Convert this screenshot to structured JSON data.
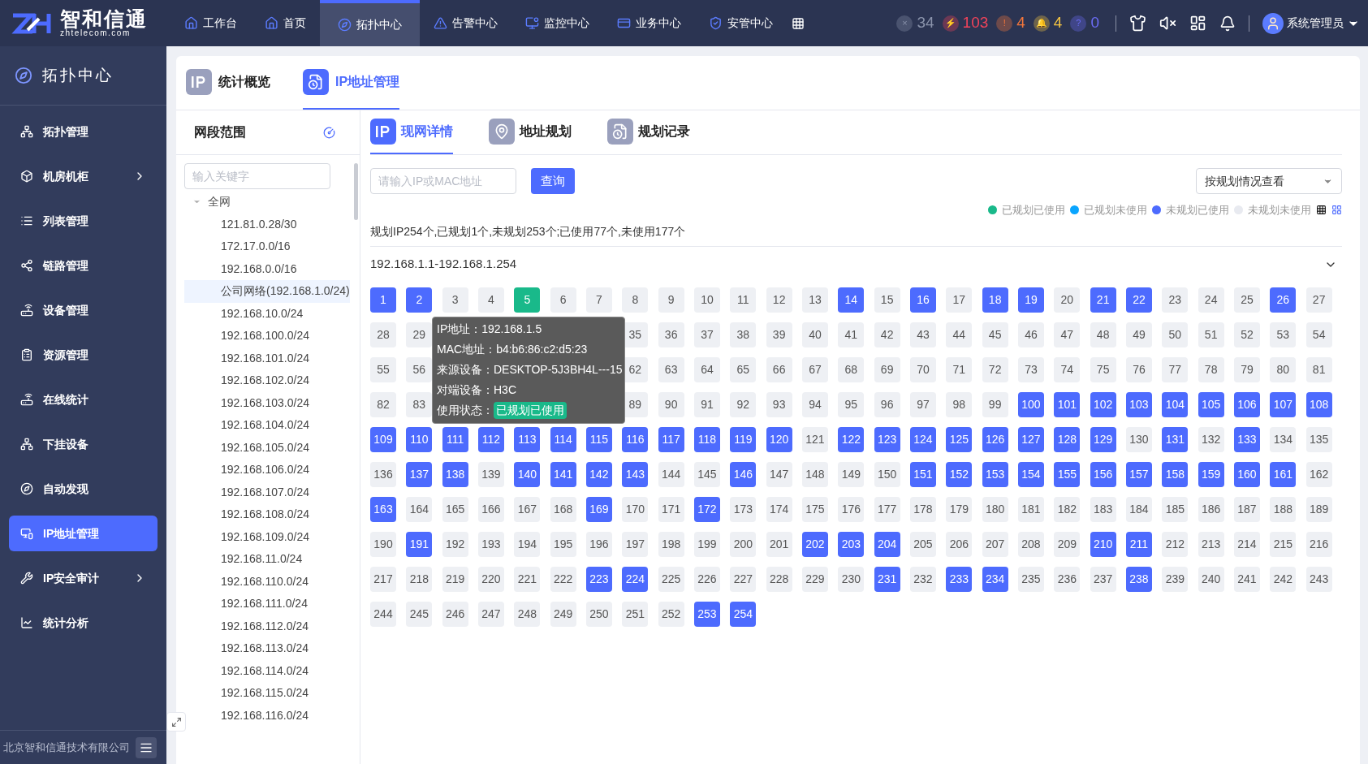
{
  "logo": {
    "name": "智和信通",
    "domain": "zhtelecom.com"
  },
  "nav": [
    {
      "label": "工作台",
      "selected": false
    },
    {
      "label": "首页",
      "selected": false
    },
    {
      "label": "拓扑中心",
      "selected": true
    },
    {
      "label": "告警中心",
      "selected": false
    },
    {
      "label": "监控中心",
      "selected": false
    },
    {
      "label": "业务中心",
      "selected": false
    },
    {
      "label": "安管中心",
      "selected": false
    }
  ],
  "alarms": [
    {
      "symbol": "×",
      "count": "34",
      "color": "#8a93ab"
    },
    {
      "symbol": "⚡",
      "count": "103",
      "color": "#f0435a"
    },
    {
      "symbol": "!",
      "count": "4",
      "color": "#f5773b"
    },
    {
      "symbol": "🔔",
      "count": "4",
      "color": "#f5c542"
    },
    {
      "symbol": "?",
      "count": "0",
      "color": "#6b6cf5"
    }
  ],
  "user": {
    "name": "系统管理员"
  },
  "sidebar": {
    "title": "拓扑中心",
    "footer": "北京智和信通技术有限公司",
    "items": [
      {
        "label": "拓扑管理",
        "selected": false,
        "has_submenu": false
      },
      {
        "label": "机房机柜",
        "selected": false,
        "has_submenu": true
      },
      {
        "label": "列表管理",
        "selected": false,
        "has_submenu": false
      },
      {
        "label": "链路管理",
        "selected": false,
        "has_submenu": false
      },
      {
        "label": "设备管理",
        "selected": false,
        "has_submenu": false
      },
      {
        "label": "资源管理",
        "selected": false,
        "has_submenu": false
      },
      {
        "label": "在线统计",
        "selected": false,
        "has_submenu": false
      },
      {
        "label": "下挂设备",
        "selected": false,
        "has_submenu": false
      },
      {
        "label": "自动发现",
        "selected": false,
        "has_submenu": false
      },
      {
        "label": "IP地址管理",
        "selected": true,
        "has_submenu": false
      },
      {
        "label": "IP安全审计",
        "selected": false,
        "has_submenu": true
      },
      {
        "label": "统计分析",
        "selected": false,
        "has_submenu": false
      }
    ]
  },
  "page_tabs": [
    {
      "label": "统计概览",
      "selected": false
    },
    {
      "label": "IP地址管理",
      "selected": true
    }
  ],
  "tree_panel": {
    "title": "网段范围",
    "search": {
      "placeholder": "输入关键字"
    },
    "tree": [
      {
        "label": "全网",
        "expanded": true,
        "selected": false,
        "children": [
          {
            "label": "121.81.0.28/30",
            "selected": false
          },
          {
            "label": "172.17.0.0/16",
            "selected": false
          },
          {
            "label": "192.168.0.0/16",
            "selected": false
          },
          {
            "label": "公司网络(192.168.1.0/24)",
            "selected": true
          },
          {
            "label": "192.168.10.0/24",
            "selected": false
          },
          {
            "label": "192.168.100.0/24",
            "selected": false
          },
          {
            "label": "192.168.101.0/24",
            "selected": false
          },
          {
            "label": "192.168.102.0/24",
            "selected": false
          },
          {
            "label": "192.168.103.0/24",
            "selected": false
          },
          {
            "label": "192.168.104.0/24",
            "selected": false
          },
          {
            "label": "192.168.105.0/24",
            "selected": false
          },
          {
            "label": "192.168.106.0/24",
            "selected": false
          },
          {
            "label": "192.168.107.0/24",
            "selected": false
          },
          {
            "label": "192.168.108.0/24",
            "selected": false
          },
          {
            "label": "192.168.109.0/24",
            "selected": false
          },
          {
            "label": "192.168.11.0/24",
            "selected": false
          },
          {
            "label": "192.168.110.0/24",
            "selected": false
          },
          {
            "label": "192.168.111.0/24",
            "selected": false
          },
          {
            "label": "192.168.112.0/24",
            "selected": false
          },
          {
            "label": "192.168.113.0/24",
            "selected": false
          },
          {
            "label": "192.168.114.0/24",
            "selected": false
          },
          {
            "label": "192.168.115.0/24",
            "selected": false
          },
          {
            "label": "192.168.116.0/24",
            "selected": false
          }
        ]
      }
    ]
  },
  "sub_tabs": [
    {
      "label": "现网详情",
      "selected": true
    },
    {
      "label": "地址规划",
      "selected": false
    },
    {
      "label": "规划记录",
      "selected": false
    }
  ],
  "query": {
    "placeholder": "请输入IP或MAC地址",
    "button": "查询",
    "view_select": "按规划情况查看"
  },
  "legend": [
    {
      "label": "已规划已使用",
      "color": "#19b98a"
    },
    {
      "label": "已规划未使用",
      "color": "#0aa5ff"
    },
    {
      "label": "未规划已使用",
      "color": "#4d6bfe"
    },
    {
      "label": "未规划未使用",
      "color": "#e8eaf0"
    }
  ],
  "summary": "规划IP254个,已规划1个,未规划253个;已使用77个,未使用177个",
  "range": {
    "label": "192.168.1.1-192.168.1.254",
    "expanded": true
  },
  "cells": [
    {
      "label": "1",
      "kind": "used"
    },
    {
      "label": "2",
      "kind": "used"
    },
    {
      "label": "3",
      "kind": "free"
    },
    {
      "label": "4",
      "kind": "free"
    },
    {
      "label": "5",
      "kind": "planned_used"
    },
    {
      "label": "6",
      "kind": "free"
    },
    {
      "label": "7",
      "kind": "free"
    },
    {
      "label": "8",
      "kind": "free"
    },
    {
      "label": "9",
      "kind": "free"
    },
    {
      "label": "10",
      "kind": "free"
    },
    {
      "label": "11",
      "kind": "free"
    },
    {
      "label": "12",
      "kind": "free"
    },
    {
      "label": "13",
      "kind": "free"
    },
    {
      "label": "14",
      "kind": "used"
    },
    {
      "label": "15",
      "kind": "free"
    },
    {
      "label": "16",
      "kind": "used"
    },
    {
      "label": "17",
      "kind": "free"
    },
    {
      "label": "18",
      "kind": "used"
    },
    {
      "label": "19",
      "kind": "used"
    },
    {
      "label": "20",
      "kind": "free"
    },
    {
      "label": "21",
      "kind": "used"
    },
    {
      "label": "22",
      "kind": "used"
    },
    {
      "label": "23",
      "kind": "free"
    },
    {
      "label": "24",
      "kind": "free"
    },
    {
      "label": "25",
      "kind": "free"
    },
    {
      "label": "26",
      "kind": "used"
    },
    {
      "label": "27",
      "kind": "free"
    },
    {
      "label": "28",
      "kind": "free"
    },
    {
      "label": "29",
      "kind": "free"
    },
    {
      "kind": "covered"
    },
    {
      "kind": "covered"
    },
    {
      "kind": "covered"
    },
    {
      "kind": "covered"
    },
    {
      "kind": "covered"
    },
    {
      "label": "35",
      "kind": "free"
    },
    {
      "label": "36",
      "kind": "free"
    },
    {
      "label": "37",
      "kind": "free"
    },
    {
      "label": "38",
      "kind": "free"
    },
    {
      "label": "39",
      "kind": "free"
    },
    {
      "label": "40",
      "kind": "free"
    },
    {
      "label": "41",
      "kind": "free"
    },
    {
      "label": "42",
      "kind": "free"
    },
    {
      "label": "43",
      "kind": "free"
    },
    {
      "label": "44",
      "kind": "free"
    },
    {
      "label": "45",
      "kind": "free"
    },
    {
      "label": "46",
      "kind": "free"
    },
    {
      "label": "47",
      "kind": "free"
    },
    {
      "label": "48",
      "kind": "free"
    },
    {
      "label": "49",
      "kind": "free"
    },
    {
      "label": "50",
      "kind": "free"
    },
    {
      "label": "51",
      "kind": "free"
    },
    {
      "label": "52",
      "kind": "free"
    },
    {
      "label": "53",
      "kind": "free"
    },
    {
      "label": "54",
      "kind": "free"
    },
    {
      "label": "55",
      "kind": "free"
    },
    {
      "label": "56",
      "kind": "free"
    },
    {
      "kind": "covered"
    },
    {
      "kind": "covered"
    },
    {
      "kind": "covered"
    },
    {
      "kind": "covered"
    },
    {
      "kind": "covered"
    },
    {
      "label": "62",
      "kind": "free"
    },
    {
      "label": "63",
      "kind": "free"
    },
    {
      "label": "64",
      "kind": "free"
    },
    {
      "label": "65",
      "kind": "free"
    },
    {
      "label": "66",
      "kind": "free"
    },
    {
      "label": "67",
      "kind": "free"
    },
    {
      "label": "68",
      "kind": "free"
    },
    {
      "label": "69",
      "kind": "free"
    },
    {
      "label": "70",
      "kind": "free"
    },
    {
      "label": "71",
      "kind": "free"
    },
    {
      "label": "72",
      "kind": "free"
    },
    {
      "label": "73",
      "kind": "free"
    },
    {
      "label": "74",
      "kind": "free"
    },
    {
      "label": "75",
      "kind": "free"
    },
    {
      "label": "76",
      "kind": "free"
    },
    {
      "label": "77",
      "kind": "free"
    },
    {
      "label": "78",
      "kind": "free"
    },
    {
      "label": "79",
      "kind": "free"
    },
    {
      "label": "80",
      "kind": "free"
    },
    {
      "label": "81",
      "kind": "free"
    },
    {
      "label": "82",
      "kind": "free"
    },
    {
      "label": "83",
      "kind": "free"
    },
    {
      "kind": "covered"
    },
    {
      "kind": "covered"
    },
    {
      "kind": "covered"
    },
    {
      "kind": "covered"
    },
    {
      "kind": "covered"
    },
    {
      "label": "89",
      "kind": "free"
    },
    {
      "label": "90",
      "kind": "free"
    },
    {
      "label": "91",
      "kind": "free"
    },
    {
      "label": "92",
      "kind": "free"
    },
    {
      "label": "93",
      "kind": "free"
    },
    {
      "label": "94",
      "kind": "free"
    },
    {
      "label": "95",
      "kind": "free"
    },
    {
      "label": "96",
      "kind": "free"
    },
    {
      "label": "97",
      "kind": "free"
    },
    {
      "label": "98",
      "kind": "free"
    },
    {
      "label": "99",
      "kind": "free"
    },
    {
      "label": "100",
      "kind": "used"
    },
    {
      "label": "101",
      "kind": "used"
    },
    {
      "label": "102",
      "kind": "used"
    },
    {
      "label": "103",
      "kind": "used"
    },
    {
      "label": "104",
      "kind": "used"
    },
    {
      "label": "105",
      "kind": "used"
    },
    {
      "label": "106",
      "kind": "used"
    },
    {
      "label": "107",
      "kind": "used"
    },
    {
      "label": "108",
      "kind": "used"
    },
    {
      "label": "109",
      "kind": "used"
    },
    {
      "label": "110",
      "kind": "used"
    },
    {
      "label": "111",
      "kind": "used"
    },
    {
      "label": "112",
      "kind": "used"
    },
    {
      "label": "113",
      "kind": "used"
    },
    {
      "label": "114",
      "kind": "used"
    },
    {
      "label": "115",
      "kind": "used"
    },
    {
      "label": "116",
      "kind": "used"
    },
    {
      "label": "117",
      "kind": "used"
    },
    {
      "label": "118",
      "kind": "used"
    },
    {
      "label": "119",
      "kind": "used"
    },
    {
      "label": "120",
      "kind": "used"
    },
    {
      "label": "121",
      "kind": "free"
    },
    {
      "label": "122",
      "kind": "used"
    },
    {
      "label": "123",
      "kind": "used"
    },
    {
      "label": "124",
      "kind": "used"
    },
    {
      "label": "125",
      "kind": "used"
    },
    {
      "label": "126",
      "kind": "used"
    },
    {
      "label": "127",
      "kind": "used"
    },
    {
      "label": "128",
      "kind": "used"
    },
    {
      "label": "129",
      "kind": "used"
    },
    {
      "label": "130",
      "kind": "free"
    },
    {
      "label": "131",
      "kind": "used"
    },
    {
      "label": "132",
      "kind": "free"
    },
    {
      "label": "133",
      "kind": "used"
    },
    {
      "label": "134",
      "kind": "free"
    },
    {
      "label": "135",
      "kind": "free"
    },
    {
      "label": "136",
      "kind": "free"
    },
    {
      "label": "137",
      "kind": "used"
    },
    {
      "label": "138",
      "kind": "used"
    },
    {
      "label": "139",
      "kind": "free"
    },
    {
      "label": "140",
      "kind": "used"
    },
    {
      "label": "141",
      "kind": "used"
    },
    {
      "label": "142",
      "kind": "used"
    },
    {
      "label": "143",
      "kind": "used"
    },
    {
      "label": "144",
      "kind": "free"
    },
    {
      "label": "145",
      "kind": "free"
    },
    {
      "label": "146",
      "kind": "used"
    },
    {
      "label": "147",
      "kind": "free"
    },
    {
      "label": "148",
      "kind": "free"
    },
    {
      "label": "149",
      "kind": "free"
    },
    {
      "label": "150",
      "kind": "free"
    },
    {
      "label": "151",
      "kind": "used"
    },
    {
      "label": "152",
      "kind": "used"
    },
    {
      "label": "153",
      "kind": "used"
    },
    {
      "label": "154",
      "kind": "used"
    },
    {
      "label": "155",
      "kind": "used"
    },
    {
      "label": "156",
      "kind": "used"
    },
    {
      "label": "157",
      "kind": "used"
    },
    {
      "label": "158",
      "kind": "used"
    },
    {
      "label": "159",
      "kind": "used"
    },
    {
      "label": "160",
      "kind": "used"
    },
    {
      "label": "161",
      "kind": "used"
    },
    {
      "label": "162",
      "kind": "free"
    },
    {
      "label": "163",
      "kind": "used"
    },
    {
      "label": "164",
      "kind": "free"
    },
    {
      "label": "165",
      "kind": "free"
    },
    {
      "label": "166",
      "kind": "free"
    },
    {
      "label": "167",
      "kind": "free"
    },
    {
      "label": "168",
      "kind": "free"
    },
    {
      "label": "169",
      "kind": "used"
    },
    {
      "label": "170",
      "kind": "free"
    },
    {
      "label": "171",
      "kind": "free"
    },
    {
      "label": "172",
      "kind": "used"
    },
    {
      "label": "173",
      "kind": "free"
    },
    {
      "label": "174",
      "kind": "free"
    },
    {
      "label": "175",
      "kind": "free"
    },
    {
      "label": "176",
      "kind": "free"
    },
    {
      "label": "177",
      "kind": "free"
    },
    {
      "label": "178",
      "kind": "free"
    },
    {
      "label": "179",
      "kind": "free"
    },
    {
      "label": "180",
      "kind": "free"
    },
    {
      "label": "181",
      "kind": "free"
    },
    {
      "label": "182",
      "kind": "free"
    },
    {
      "label": "183",
      "kind": "free"
    },
    {
      "label": "184",
      "kind": "free"
    },
    {
      "label": "185",
      "kind": "free"
    },
    {
      "label": "186",
      "kind": "free"
    },
    {
      "label": "187",
      "kind": "free"
    },
    {
      "label": "188",
      "kind": "free"
    },
    {
      "label": "189",
      "kind": "free"
    },
    {
      "label": "190",
      "kind": "free"
    },
    {
      "label": "191",
      "kind": "used"
    },
    {
      "label": "192",
      "kind": "free"
    },
    {
      "label": "193",
      "kind": "free"
    },
    {
      "label": "194",
      "kind": "free"
    },
    {
      "label": "195",
      "kind": "free"
    },
    {
      "label": "196",
      "kind": "free"
    },
    {
      "label": "197",
      "kind": "free"
    },
    {
      "label": "198",
      "kind": "free"
    },
    {
      "label": "199",
      "kind": "free"
    },
    {
      "label": "200",
      "kind": "free"
    },
    {
      "label": "201",
      "kind": "free"
    },
    {
      "label": "202",
      "kind": "used"
    },
    {
      "label": "203",
      "kind": "used"
    },
    {
      "label": "204",
      "kind": "used"
    },
    {
      "label": "205",
      "kind": "free"
    },
    {
      "label": "206",
      "kind": "free"
    },
    {
      "label": "207",
      "kind": "free"
    },
    {
      "label": "208",
      "kind": "free"
    },
    {
      "label": "209",
      "kind": "free"
    },
    {
      "label": "210",
      "kind": "used"
    },
    {
      "label": "211",
      "kind": "used"
    },
    {
      "label": "212",
      "kind": "free"
    },
    {
      "label": "213",
      "kind": "free"
    },
    {
      "label": "214",
      "kind": "free"
    },
    {
      "label": "215",
      "kind": "free"
    },
    {
      "label": "216",
      "kind": "free"
    },
    {
      "label": "217",
      "kind": "free"
    },
    {
      "label": "218",
      "kind": "free"
    },
    {
      "label": "219",
      "kind": "free"
    },
    {
      "label": "220",
      "kind": "free"
    },
    {
      "label": "221",
      "kind": "free"
    },
    {
      "label": "222",
      "kind": "free"
    },
    {
      "label": "223",
      "kind": "used"
    },
    {
      "label": "224",
      "kind": "used"
    },
    {
      "label": "225",
      "kind": "free"
    },
    {
      "label": "226",
      "kind": "free"
    },
    {
      "label": "227",
      "kind": "free"
    },
    {
      "label": "228",
      "kind": "free"
    },
    {
      "label": "229",
      "kind": "free"
    },
    {
      "label": "230",
      "kind": "free"
    },
    {
      "label": "231",
      "kind": "used"
    },
    {
      "label": "232",
      "kind": "free"
    },
    {
      "label": "233",
      "kind": "used"
    },
    {
      "label": "234",
      "kind": "used"
    },
    {
      "label": "235",
      "kind": "free"
    },
    {
      "label": "236",
      "kind": "free"
    },
    {
      "label": "237",
      "kind": "free"
    },
    {
      "label": "238",
      "kind": "used"
    },
    {
      "label": "239",
      "kind": "free"
    },
    {
      "label": "240",
      "kind": "free"
    },
    {
      "label": "241",
      "kind": "free"
    },
    {
      "label": "242",
      "kind": "free"
    },
    {
      "label": "243",
      "kind": "free"
    },
    {
      "label": "244",
      "kind": "free"
    },
    {
      "label": "245",
      "kind": "free"
    },
    {
      "label": "246",
      "kind": "free"
    },
    {
      "label": "247",
      "kind": "free"
    },
    {
      "label": "248",
      "kind": "free"
    },
    {
      "label": "249",
      "kind": "free"
    },
    {
      "label": "250",
      "kind": "free"
    },
    {
      "label": "251",
      "kind": "free"
    },
    {
      "label": "252",
      "kind": "free"
    },
    {
      "label": "253",
      "kind": "used"
    },
    {
      "label": "254",
      "kind": "used"
    }
  ],
  "tooltip": {
    "rows": [
      {
        "label": "IP地址：",
        "value": "192.168.1.5",
        "kind": "text"
      },
      {
        "label": "MAC地址：",
        "value": "b4:b6:86:c2:d5:23",
        "kind": "text"
      },
      {
        "label": "来源设备：",
        "value": "DESKTOP-5J3BH4L---15",
        "kind": "text"
      },
      {
        "label": "对端设备：",
        "value": "H3C",
        "kind": "text"
      },
      {
        "label": "使用状态：",
        "value": "已规划已使用",
        "kind": "badge"
      }
    ]
  }
}
